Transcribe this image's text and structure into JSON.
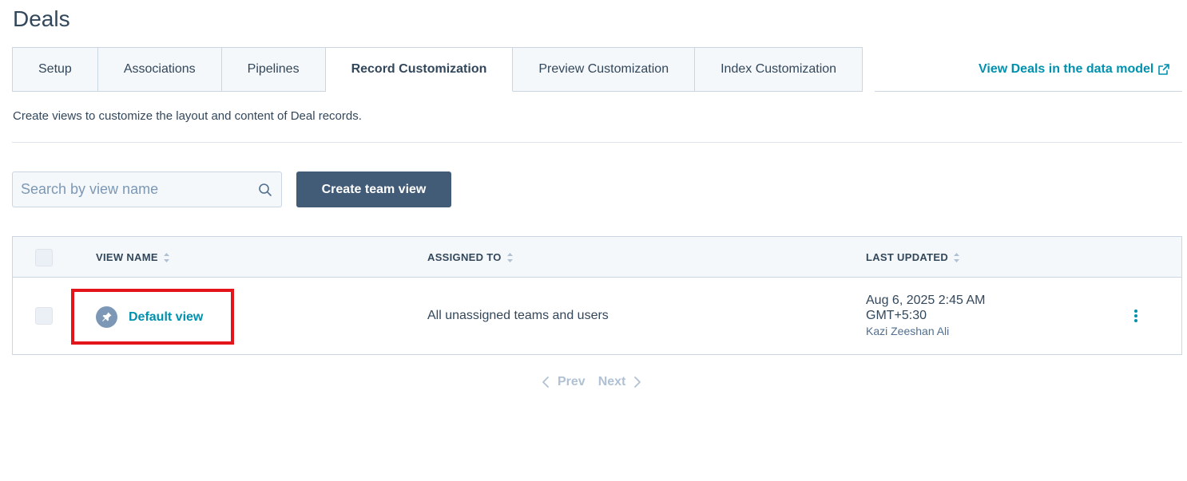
{
  "page": {
    "title": "Deals"
  },
  "tabs": [
    {
      "label": "Setup",
      "active": false
    },
    {
      "label": "Associations",
      "active": false
    },
    {
      "label": "Pipelines",
      "active": false
    },
    {
      "label": "Record Customization",
      "active": true
    },
    {
      "label": "Preview Customization",
      "active": false
    },
    {
      "label": "Index Customization",
      "active": false
    }
  ],
  "data_model_link": {
    "label": "View Deals in the data model",
    "icon": "external-link-icon"
  },
  "description": "Create views to customize the layout and content of Deal records.",
  "search": {
    "placeholder": "Search by view name",
    "value": "",
    "icon": "search-icon"
  },
  "create_button": {
    "label": "Create team view"
  },
  "table": {
    "columns": [
      {
        "label": "VIEW NAME",
        "sortable": true
      },
      {
        "label": "ASSIGNED TO",
        "sortable": true
      },
      {
        "label": "LAST UPDATED",
        "sortable": true
      }
    ],
    "rows": [
      {
        "view_name": "Default view",
        "icon": "pin-icon",
        "assigned_to": "All unassigned teams and users",
        "last_updated_date": "Aug 6, 2025 2:45 AM",
        "last_updated_tz": "GMT+5:30",
        "last_updated_by": "Kazi Zeeshan Ali"
      }
    ]
  },
  "pagination": {
    "prev": "Prev",
    "next": "Next"
  },
  "colors": {
    "link": "#0091ae",
    "primary_button": "#425b76",
    "highlight": "#e3141a",
    "text": "#33475b"
  }
}
